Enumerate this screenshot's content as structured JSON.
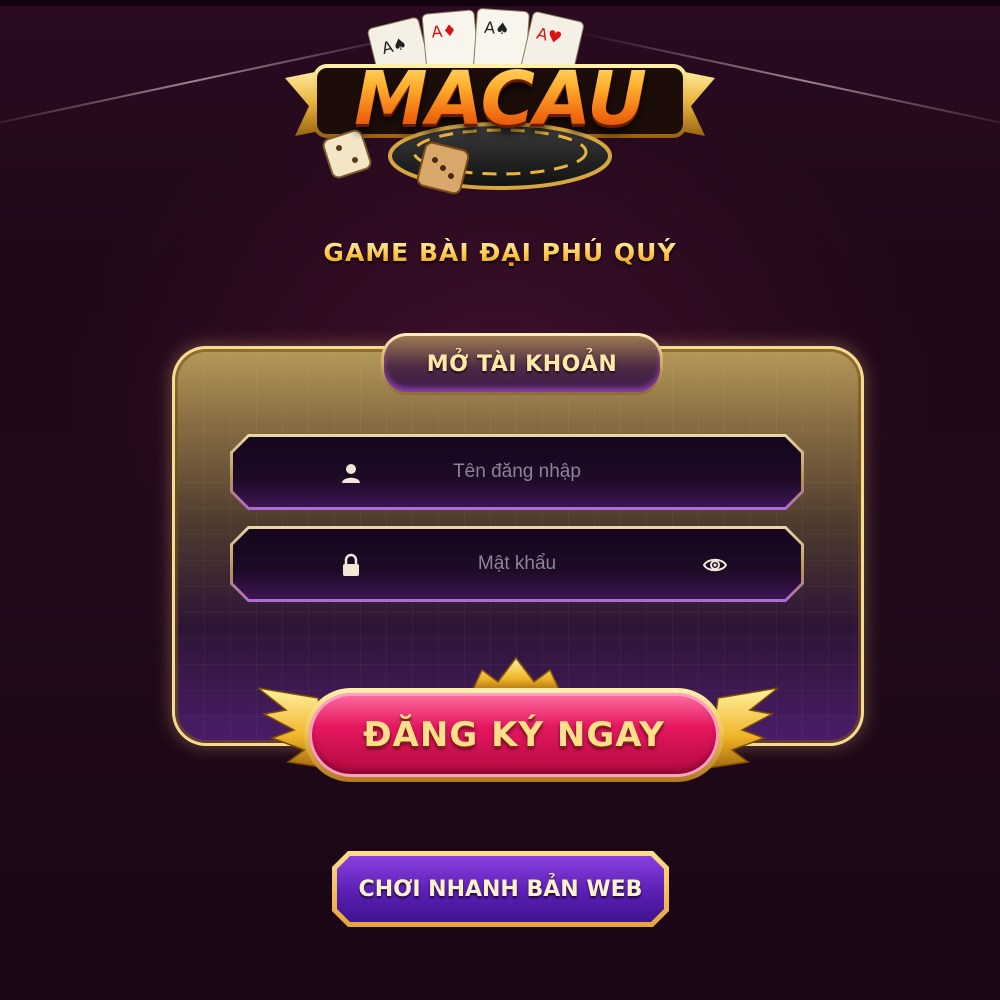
{
  "brand": {
    "logo_text": "MACAU",
    "tagline": "GAME BÀI ĐẠI PHÚ QUÝ"
  },
  "register_panel": {
    "header": "MỞ TÀI KHOẢN",
    "username": {
      "placeholder": "Tên đăng nhập",
      "icon": "user-icon"
    },
    "password": {
      "placeholder": "Mật khẩu",
      "icon": "lock-icon",
      "toggle_icon": "eye-icon"
    },
    "register_button": "ĐĂNG KÝ NGAY"
  },
  "web_play_button": "CHƠI NHANH BẢN WEB",
  "colors": {
    "background": "#200a1b",
    "gold": "#ffd26a",
    "register_pink": "#e5175f",
    "web_purple": "#5b1fb4"
  }
}
